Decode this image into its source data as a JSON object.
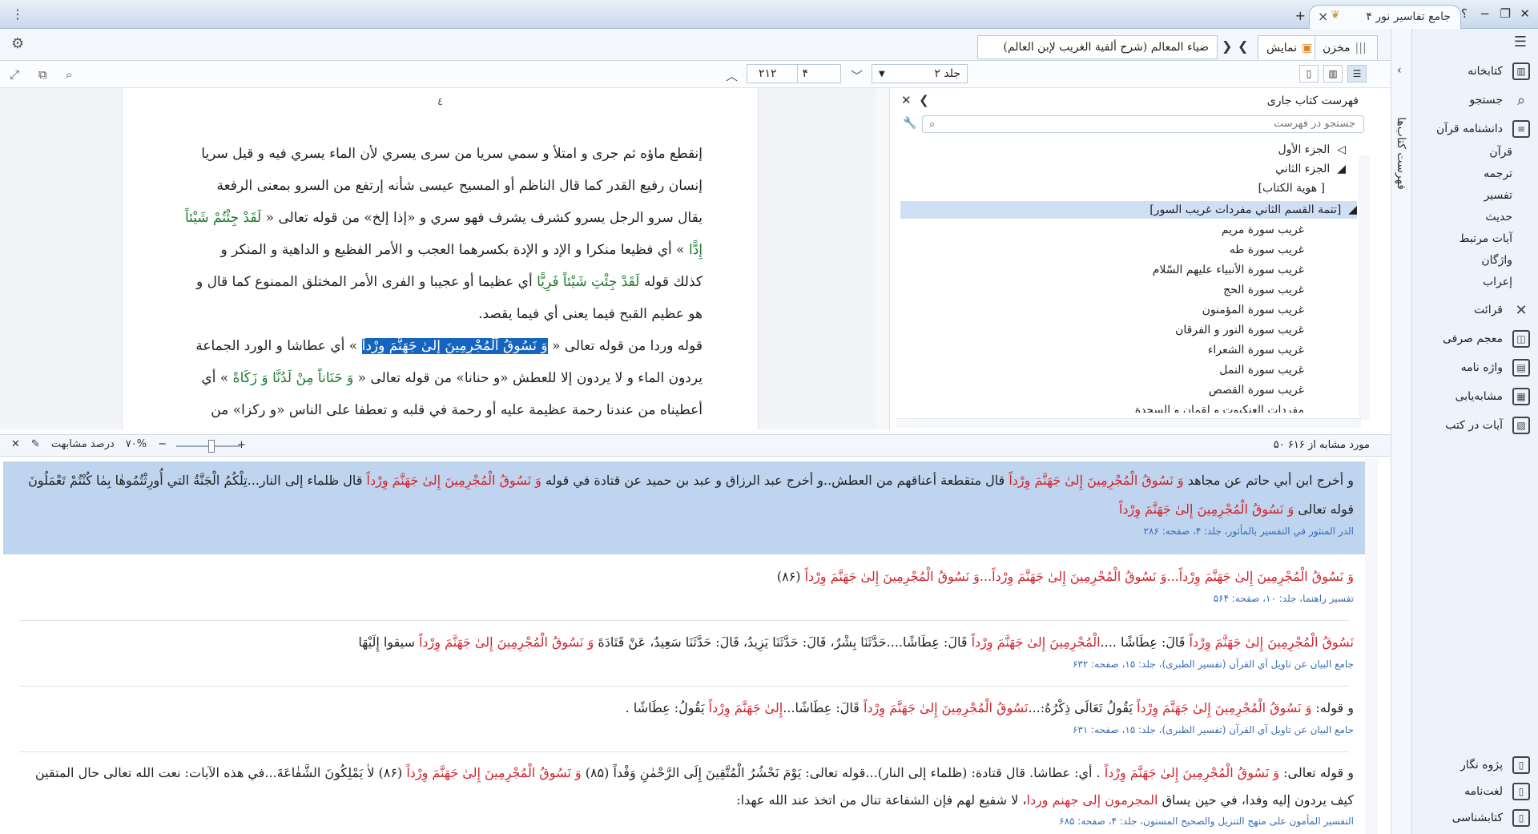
{
  "titlebar": {
    "app_tab": "جامع تفاسیر نور ۴",
    "new_tab": "+",
    "help": "؟",
    "menu_dots": "⋮"
  },
  "sidebar": {
    "items": [
      {
        "label": "کتابخانه",
        "icon": "library-icon"
      },
      {
        "label": "جستجو",
        "icon": "search-icon"
      },
      {
        "label": "دانشنامه قرآن",
        "icon": "encyclopedia-icon"
      }
    ],
    "sub_items": [
      "قرآن",
      "ترجمه",
      "تفسیر",
      "حدیث",
      "آیات مرتبط",
      "واژگان",
      "إعراب"
    ],
    "items2": [
      {
        "label": "قرائت",
        "icon": "qiraat-icon"
      },
      {
        "label": "معجم صرفی",
        "icon": "morphology-icon"
      },
      {
        "label": "واژه نامه",
        "icon": "glossary-icon"
      },
      {
        "label": "مشابه‌یابی",
        "icon": "similarity-icon"
      },
      {
        "label": "آیات در کتب",
        "icon": "verses-in-books-icon"
      }
    ],
    "bottom_items": [
      {
        "label": "پژوه نگار",
        "icon": "notes-icon"
      },
      {
        "label": "لغت‌نامه",
        "icon": "dictionary-icon"
      },
      {
        "label": "کتابشناسی",
        "icon": "bibliography-icon"
      }
    ]
  },
  "vtab": {
    "label": "فهرست کتاب‌ها"
  },
  "tabrow": {
    "repository": "مخزن",
    "display": "نمایش",
    "book_title": "ضياء المعالم (شرح ألفية الغريب لإبن العالم)"
  },
  "toolbar": {
    "volume": "جلد ۲",
    "page_current": "۴",
    "page_total": "۲۱۲"
  },
  "reader": {
    "page_number": "٤",
    "lines": [
      "إنقطع ماؤه ثم جرى و امتلأ و سمي سريا من سرى يسري لأن الماء يسري فيه و قيل سريا",
      "إنسان رفيع القدر كما قال الناظم أو المسيح عيسى شأنه إرتفع من السرو بمعنى الرفعة"
    ],
    "line3_a": "يقال سرو الرجل يسرو كشرف يشرف فهو سري و «إذا إلخ» من قوله تعالى «",
    "line3_verse": " لَقَدْ جِئْتُمْ شَيْئاً",
    "line4_verse": "إِدًّا",
    "line4_b": " » أي فظيعا منكرا و الإد و الإدة بكسرهما العجب و الأمر الفظيع و الداهية و المنكر و",
    "line5_a": "كذلك قوله ",
    "line5_verse": "لَقَدْ جِئْتِ شَيْئاً فَرِيًّا",
    "line5_b": " أي عظيما أو عجيبا و الفرى الأمر المختلق الممنوع كما قال و",
    "line6": "هو عظيم القبح فيما يعنى أي فيما يقصد.",
    "line7_a": "قوله وردا من قوله تعالى « ",
    "line7_hl": "وَ نَسُوقُ اَلْمُجْرِمِينَ إِلىٰ جَهَنَّمَ وِرْداً",
    "line7_b": " » أي عطاشا و الورد الجماعة",
    "line8_a": "يردون الماء و لا يردون إلا للعطش «و حنانا» من قوله تعالى « ",
    "line8_verse": "وَ حَنَاناً مِنْ لَدُنَّا وَ زَكَاةً",
    "line8_b": " » أي",
    "line9": "أعطيناه من عندنا رحمة عظيمة عليه أو رحمة في قلبه و تعطفا على الناس «و ركزا» من"
  },
  "toc": {
    "title": "فهرست کتاب جاری",
    "search_placeholder": "جستجو در فهرست",
    "rows": [
      {
        "label": "الجزء الأول",
        "arrow": "◁"
      },
      {
        "label": "الجزء الثاني",
        "arrow": "◢"
      },
      {
        "label": "[ هوية الكتاب]",
        "arrow": ""
      },
      {
        "label": "[تتمة القسم الثاني مفردات غريب السور]",
        "arrow": "◢"
      },
      {
        "label": "غريب سورة مريم",
        "arrow": ""
      },
      {
        "label": "غريب سورة طه",
        "arrow": ""
      },
      {
        "label": "غريب سورة الأنبياء عليهم السّلام",
        "arrow": ""
      },
      {
        "label": "غريب سورة الحج",
        "arrow": ""
      },
      {
        "label": "غريب سورة المؤمنون",
        "arrow": ""
      },
      {
        "label": "غريب سورة النور و الفرقان",
        "arrow": ""
      },
      {
        "label": "غريب سورة الشعراء",
        "arrow": ""
      },
      {
        "label": "غريب سورة النمل",
        "arrow": ""
      },
      {
        "label": "غريب سورة القصص",
        "arrow": ""
      },
      {
        "label": "مفردات العنكبوت و لقمان و السجدة",
        "arrow": ""
      }
    ]
  },
  "simbar": {
    "count": "۵۰ مورد مشابه از ۶۱۶",
    "percent_label": "درصد مشابهت",
    "percent": "۷۰%",
    "plus": "+",
    "minus": "−"
  },
  "results": [
    {
      "segments": [
        {
          "t": "و أخرج ابن أبي حاتم عن مجاهد ",
          "c": ""
        },
        {
          "t": "وَ نَسُوقُ الْمُجْرِمِينَ إِلىٰ جَهَنَّمَ وِرْداً",
          "c": "red"
        },
        {
          "t": " قال متقطعة أعناقهم من العطش..و أخرج عبد الرزاق و عبد بن حميد عن قتادة في قوله ",
          "c": ""
        },
        {
          "t": "وَ نَسُوقُ الْمُجْرِمِينَ إِلىٰ جَهَنَّمَ وِرْداً",
          "c": "red"
        },
        {
          "t": " قال ظلماء إلى النار...تِلْكُمُ الْجَنَّةُ التي أُورِثْتُمُوهٰا بِمٰا كُنْتُمْ تَعْمَلُونَ قوله تعالى ",
          "c": ""
        },
        {
          "t": "وَ نَسُوقُ الْمُجْرِمِينَ إِلىٰ جَهَنَّمَ وِرْداً",
          "c": "red"
        }
      ],
      "source": "الدر المنثور في التفسير بالمأثور، جلد: ۴، صفحه: ۲۸۶"
    },
    {
      "segments": [
        {
          "t": "وَ نَسُوقُ الْمُجْرِمِينَ إِلىٰ جَهَنَّمَ وِرْداً...وَ نَسُوقُ الْمُجْرِمِينَ إِلىٰ جَهَنَّمَ وِرْداً...وَ نَسُوقُ الْمُجْرِمِينَ إِلىٰ جَهَنَّمَ وِرْداً",
          "c": "red"
        },
        {
          "t": " (۸۶)",
          "c": ""
        }
      ],
      "source": "تفسير راهنما، جلد: ۱۰، صفحه: ۵۶۴"
    },
    {
      "segments": [
        {
          "t": "نَسُوقُ الْمُجْرِمِينَ إِلىٰ جَهَنَّمَ وِرْداً",
          "c": "red"
        },
        {
          "t": " قَالَ: عِطَاشًا ....",
          "c": ""
        },
        {
          "t": "الْمُجْرِمِينَ إِلىٰ جَهَنَّمَ وِرْداً",
          "c": "red"
        },
        {
          "t": " قَالَ: عِطَاشًا....حَدَّثَنَا بِشْرٌ، قَالَ: حَدَّثَنَا يَزِيدُ، قَالَ: حَدَّثَنَا سَعِيدٌ، عَنْ قَتَادَةَ ",
          "c": ""
        },
        {
          "t": "وَ نَسُوقُ الْمُجْرِمِينَ إِلىٰ جَهَنَّمَ وِرْداً",
          "c": "red"
        },
        {
          "t": " سيقوا إِلَيْهَا",
          "c": ""
        }
      ],
      "source": "جامع البيان عن تاويل آي القرآن (تفسير الطبرى)، جلد: ۱۵، صفحه: ۶۳۲"
    },
    {
      "segments": [
        {
          "t": "و قوله: ",
          "c": ""
        },
        {
          "t": "وَ نَسُوقُ الْمُجْرِمِينَ إِلىٰ جَهَنَّمَ وِرْداً",
          "c": "red"
        },
        {
          "t": " يَقُولُ تَعَالَى ذِكْرُهُ:...",
          "c": ""
        },
        {
          "t": "نَسُوقُ الْمُجْرِمِينَ إِلىٰ جَهَنَّمَ وِرْداً",
          "c": "red"
        },
        {
          "t": " قَالَ: عِطَاشًا...",
          "c": ""
        },
        {
          "t": "إِلىٰ جَهَنَّمَ وِرْداً",
          "c": "red"
        },
        {
          "t": " يَقُولُ: عِطَاشًا .",
          "c": ""
        }
      ],
      "source": "جامع البيان عن تاويل آي القرآن (تفسير الطبرى)، جلد: ۱۵، صفحه: ۶۳۱"
    },
    {
      "segments": [
        {
          "t": "و قوله تعالى: ",
          "c": ""
        },
        {
          "t": "وَ نَسُوقُ الْمُجْرِمِينَ إِلىٰ جَهَنَّمَ وِرْداً",
          "c": "red"
        },
        {
          "t": " . أي: عطاشا. قال قتادة: (ظلماء إلى النار)...قوله تعالى: يَوْمَ نَحْشُرُ الْمُتَّقِينَ إِلَى الرَّحْمٰنِ وَفْداً (۸۵) ",
          "c": ""
        },
        {
          "t": "وَ نَسُوقُ الْمُجْرِمِينَ إِلىٰ جَهَنَّمَ وِرْداً",
          "c": "red"
        },
        {
          "t": " (۸۶) لاٰ يَمْلِكُونَ الشَّفٰاعَةَ...في هذه الآيات: نعت الله تعالى حال المتقين كيف يردون إليه وفدا، في حين يساق ",
          "c": ""
        },
        {
          "t": "المجرمون إلى جهنم وردا",
          "c": "red"
        },
        {
          "t": "، لا شفيع لهم فإن الشفاعة تنال من اتخذ عند الله عهدا:",
          "c": ""
        }
      ],
      "source": "التفسير المأمون على منهج التنزيل والصحيح المسنون، جلد: ۴، صفحه: ۶۸۵"
    }
  ]
}
